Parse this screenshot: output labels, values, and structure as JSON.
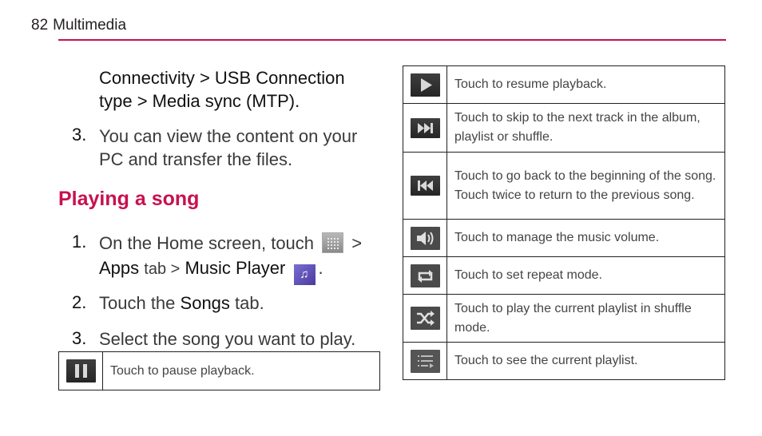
{
  "header": {
    "page_number": "82",
    "section": "Multimedia",
    "accent_color": "#c8104f"
  },
  "intro": {
    "continuation_line1": "Connectivity > USB Connection",
    "continuation_line2": "type > Media sync (MTP).",
    "step3_number": "3.",
    "step3_line1": "You can view the content on your",
    "step3_line2": "PC and transfer the files."
  },
  "section": {
    "heading": "Playing a song",
    "steps": [
      {
        "number": "1.",
        "text_a": "On the Home screen, touch",
        "sep": ">",
        "bold_a": "Apps",
        "text_b": "tab >",
        "bold_b": "Music Player",
        "end": "."
      },
      {
        "number": "2.",
        "text_a": "Touch the",
        "bold_a": "Songs",
        "text_b": "tab."
      },
      {
        "number": "3.",
        "text_a": "Select the song you want to play."
      }
    ]
  },
  "left_table": [
    {
      "icon": "pause-icon",
      "text": "Touch to pause playback."
    }
  ],
  "right_table": [
    {
      "icon": "play-icon",
      "text": "Touch to resume playback."
    },
    {
      "icon": "skip-next-icon",
      "text": "Touch to skip to the next track in the album, playlist or shuffle."
    },
    {
      "icon": "skip-previous-icon",
      "text": "Touch to go back to the beginning of the song. Touch twice to return to the previous song."
    },
    {
      "icon": "volume-icon",
      "text": "Touch to manage the music volume."
    },
    {
      "icon": "repeat-icon",
      "text": "Touch to set repeat mode."
    },
    {
      "icon": "shuffle-icon",
      "text": "Touch to play the current playlist in shuffle mode."
    },
    {
      "icon": "playlist-icon",
      "text": "Touch to see the current playlist."
    }
  ]
}
